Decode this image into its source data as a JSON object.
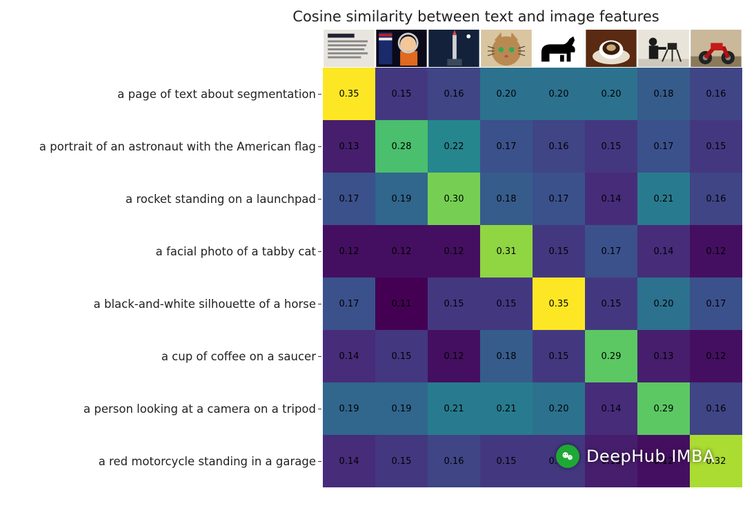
{
  "title": "Cosine similarity between text and image features",
  "row_labels": [
    "a page of text about segmentation",
    "a portrait of an astronaut with the American flag",
    "a rocket standing on a launchpad",
    "a facial photo of a tabby cat",
    "a black-and-white silhouette of a horse",
    "a cup of coffee on a saucer",
    "a person looking at a camera on a tripod",
    "a red motorcycle standing in a garage"
  ],
  "col_thumbs": [
    "page-text",
    "astronaut",
    "rocket",
    "cat",
    "horse",
    "coffee",
    "photographer",
    "motorcycle"
  ],
  "watermark": "DeepHub IMBA",
  "chart_data": {
    "type": "heatmap",
    "title": "Cosine similarity between text and image features",
    "xlabel": "",
    "ylabel": "",
    "y_categories": [
      "a page of text about segmentation",
      "a portrait of an astronaut with the American flag",
      "a rocket standing on a launchpad",
      "a facial photo of a tabby cat",
      "a black-and-white silhouette of a horse",
      "a cup of coffee on a saucer",
      "a person looking at a camera on a tripod",
      "a red motorcycle standing in a garage"
    ],
    "x_categories": [
      "page-text",
      "astronaut",
      "rocket",
      "cat",
      "horse",
      "coffee",
      "photographer",
      "motorcycle"
    ],
    "values": [
      [
        0.35,
        0.15,
        0.16,
        0.2,
        0.2,
        0.2,
        0.18,
        0.16
      ],
      [
        0.13,
        0.28,
        0.22,
        0.17,
        0.16,
        0.15,
        0.17,
        0.15
      ],
      [
        0.17,
        0.19,
        0.3,
        0.18,
        0.17,
        0.14,
        0.21,
        0.16
      ],
      [
        0.12,
        0.12,
        0.12,
        0.31,
        0.15,
        0.17,
        0.14,
        0.12
      ],
      [
        0.17,
        0.11,
        0.15,
        0.15,
        0.35,
        0.15,
        0.2,
        0.17
      ],
      [
        0.14,
        0.15,
        0.12,
        0.18,
        0.15,
        0.29,
        0.13,
        0.12
      ],
      [
        0.19,
        0.19,
        0.21,
        0.21,
        0.2,
        0.14,
        0.29,
        0.16
      ],
      [
        0.14,
        0.15,
        0.16,
        0.15,
        0.15,
        0.13,
        0.12,
        0.32
      ]
    ],
    "value_range": [
      0.11,
      0.35
    ],
    "colormap": "viridis",
    "annotate": true
  }
}
